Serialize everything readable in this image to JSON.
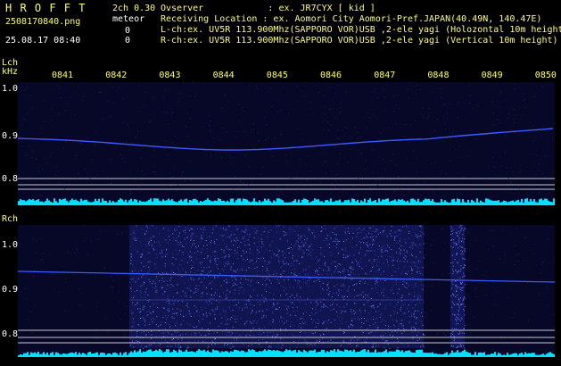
{
  "header": {
    "brand": "H R O F F T",
    "mode": "2ch 0.30",
    "meteor_label": "meteor",
    "filename": "2508170840.png",
    "datetime": "25.08.17 08:40",
    "count_l": "0",
    "count_r": "0",
    "observer": "Ovserver            : ex. JR7CYX [ kid ]",
    "location": "Receiving Location : ex. Aomori City Aomori-Pref.JAPAN(40.49N, 140.47E)",
    "lch_info": "L-ch:ex. UV5R 113.900Mhz(SAPPORO VOR)USB ,2-ele yagi (Holozontal 10m height",
    "rch_info": "R-ch:ex. UV5R 113.900Mhz(SAPPORO VOR)USB ,2-ele yagi (Vertical 10m height)"
  },
  "lch": {
    "label": "Lch",
    "unit": "kHz",
    "time_ticks": [
      "0841",
      "0842",
      "0843",
      "0844",
      "0845",
      "0846",
      "0847",
      "0848",
      "0849",
      "0850"
    ],
    "y_ticks": [
      "1.0",
      "0.9",
      "0.8"
    ]
  },
  "rch": {
    "label": "Rch",
    "y_ticks": [
      "1.0",
      "0.9",
      "0.8"
    ]
  },
  "colors": {
    "background": "#000000",
    "panel": "#070728",
    "trace": "#3a5cff",
    "noise": "#00e0ff",
    "text_yellow": "#ffff66"
  }
}
